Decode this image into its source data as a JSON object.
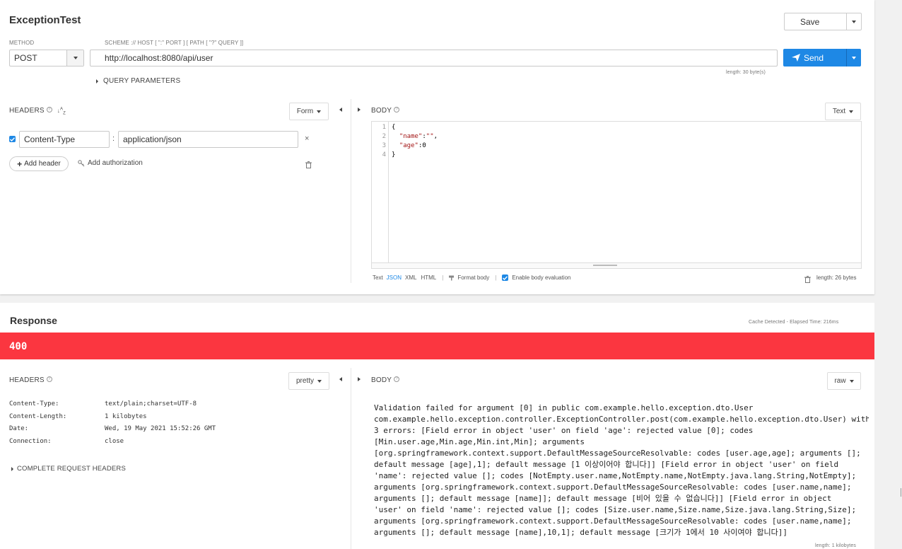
{
  "request": {
    "title": "ExceptionTest",
    "save_label": "Save",
    "method_label": "METHOD",
    "method_value": "POST",
    "scheme_label": "SCHEME :// HOST [ \":\" PORT ] [ PATH [ \"?\" QUERY ]]",
    "url": "http://localhost:8080/api/user",
    "send_label": "Send",
    "length_note": "length: 30 byte(s)",
    "query_params_label": "QUERY PARAMETERS",
    "headers_label": "HEADERS",
    "headers_mode": "Form",
    "header_rows": [
      {
        "name": "Content-Type",
        "value": "application/json",
        "enabled": true
      }
    ],
    "add_header_label": "Add header",
    "add_authorization_label": "Add authorization",
    "body_label": "BODY",
    "body_mode": "Text",
    "body_lines": [
      "{",
      "  \"name\":\"\",",
      "  \"age\":0",
      "}"
    ],
    "body_footer": {
      "formats": [
        "Text",
        "JSON",
        "XML",
        "HTML"
      ],
      "active_format": "JSON",
      "format_body_label": "Format body",
      "enable_eval_label": "Enable body evaluation",
      "enable_eval_checked": true,
      "length": "length: 26 bytes"
    }
  },
  "response": {
    "title": "Response",
    "cache_note": "Cache Detected - Elapsed Time: 216ms",
    "status_code": "400",
    "status_color": "#fb3640",
    "headers_label": "HEADERS",
    "headers_mode": "pretty",
    "headers": [
      {
        "name": "Content-Type:",
        "value": "text/plain;charset=UTF-8"
      },
      {
        "name": "Content-Length:",
        "value": "1 kilobytes"
      },
      {
        "name": "Date:",
        "value": "Wed, 19 May 2021 15:52:26 GMT"
      },
      {
        "name": "Connection:",
        "value": "close"
      }
    ],
    "complete_headers_label": "COMPLETE REQUEST HEADERS",
    "body_label": "BODY",
    "body_mode": "raw",
    "body_lines": [
      "Validation failed for argument [0] in public com.example.hello.exception.dto.User",
      "com.example.hello.exception.controller.ExceptionController.post(com.example.hello.exception.dto.User) with",
      "3 errors: [Field error in object 'user' on field 'age': rejected value [0]; codes",
      "[Min.user.age,Min.age,Min.int,Min]; arguments",
      "[org.springframework.context.support.DefaultMessageSourceResolvable: codes [user.age,age]; arguments [];",
      "default message [age],1]; default message [1 이상이어야 합니다]] [Field error in object 'user' on field",
      "'name': rejected value []; codes [NotEmpty.user.name,NotEmpty.name,NotEmpty.java.lang.String,NotEmpty];",
      "arguments [org.springframework.context.support.DefaultMessageSourceResolvable: codes [user.name,name];",
      "arguments []; default message [name]]; default message [비어 있을 수 없습니다]] [Field error in object",
      "'user' on field 'name': rejected value []; codes [Size.user.name,Size.name,Size.java.lang.String,Size];",
      "arguments [org.springframework.context.support.DefaultMessageSourceResolvable: codes [user.name,name];",
      "arguments []; default message [name],10,1]; default message [크기가 1에서 10 사이여야 합니다]]"
    ],
    "length": "length: 1 kilobytes"
  },
  "colors": {
    "accent": "#2b8fe0",
    "send": "#1e88e5",
    "error": "#fb3640"
  }
}
